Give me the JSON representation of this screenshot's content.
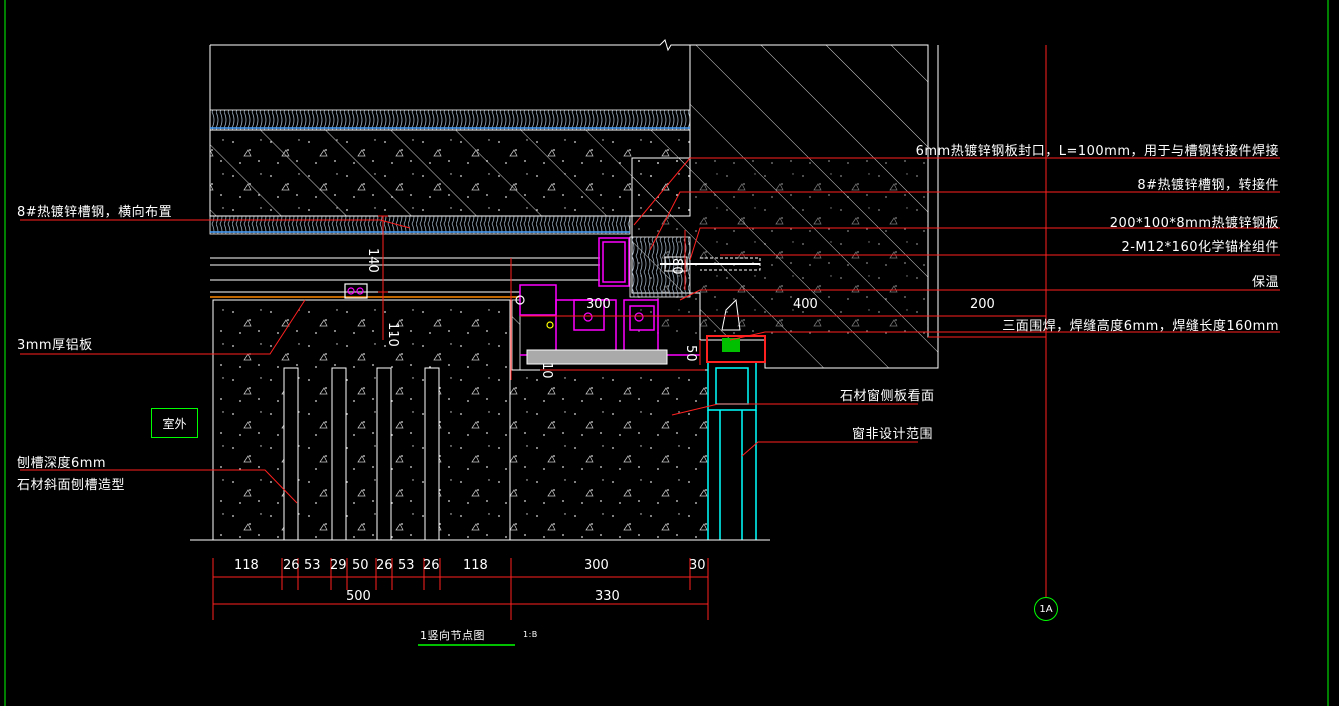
{
  "annotations": {
    "seal_plate": "6mm热镀锌钢板封口，L=100mm，用于与槽钢转接件焊接",
    "channel_adapter": "8#热镀锌槽钢，转接件",
    "steel_plate": "200*100*8mm热镀锌钢板",
    "anchor_bolt": "2-M12*160化学锚栓组件",
    "insulation": "保温",
    "weld_note": "三面围焊，焊缝高度6mm，焊缝长度160mm",
    "channel_horizontal": "8#热镀锌槽钢，横向布置",
    "aluminum_plate": "3mm厚铝板",
    "groove_depth": "刨槽深度6mm",
    "groove_shape": "石材斜面刨槽造型",
    "stone_sill": "石材窗侧板看面",
    "window_scope": "窗非设计范围"
  },
  "room_label": "室外",
  "axis_label": "1A",
  "title": {
    "main": "1竖向节点图",
    "scale": "1:B"
  },
  "inner_dims": {
    "d140": "140",
    "d110": "110",
    "d80": "80",
    "d300": "300",
    "d400": "400",
    "d200": "200",
    "d50": "50",
    "d10": "10"
  },
  "bottom_dims": {
    "row1": [
      "118",
      "26",
      "53",
      "29",
      "50",
      "26",
      "53",
      "26",
      "118",
      "300",
      "30"
    ],
    "row2": [
      "500",
      "330"
    ]
  },
  "colors": {
    "background": "#000000",
    "dimension_line": "#ff2020",
    "outline": "#ffffff",
    "steel": "#ff00ff",
    "window_frame": "#00ffff",
    "insulation_strip": "#4aa3ff",
    "tag_border": "#00ff00"
  }
}
